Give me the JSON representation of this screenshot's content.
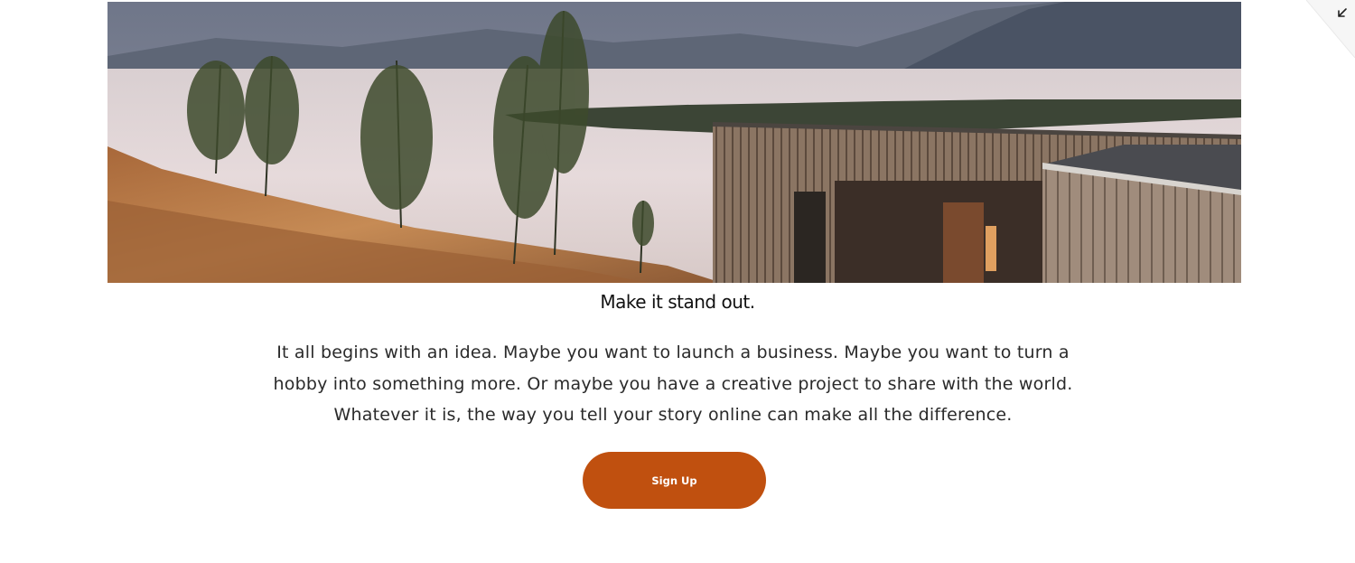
{
  "hero": {
    "image_icon": "lakeside-cabin-photo"
  },
  "corner": {
    "icon": "collapse-arrow-icon"
  },
  "content": {
    "heading": "Make it stand out.",
    "paragraph_lines": [
      "It all begins with an idea. Maybe you want to launch a business. Maybe you want to turn a",
      "hobby into something more. Or maybe you have a creative project to share with the world.",
      "Whatever it is, the way you tell your story online can make all the difference."
    ],
    "cta_label": "Sign Up"
  },
  "colors": {
    "accent": "#c0500f",
    "text": "#1f1f1f",
    "background": "#ffffff"
  }
}
